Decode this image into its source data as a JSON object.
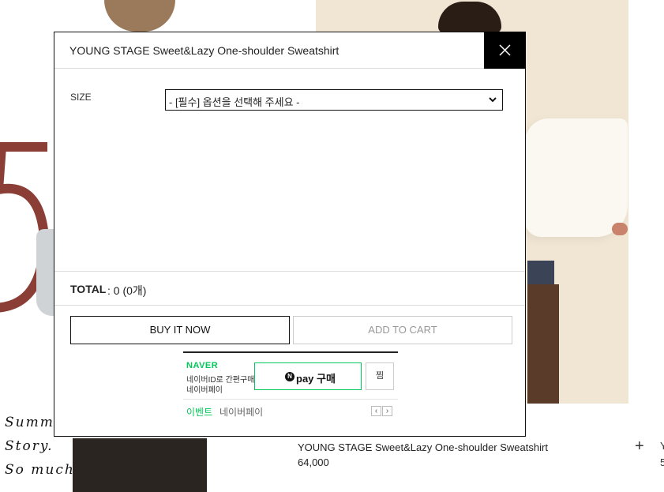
{
  "modal": {
    "title": "YOUNG STAGE Sweet&Lazy One-shoulder Sweatshirt",
    "size_label": "SIZE",
    "size_select_value": "- [필수] 옵션을 선택해 주세요 -",
    "total_label": "TOTAL",
    "total_value": ": 0 (0개)",
    "buy_now_label": "BUY IT NOW",
    "add_to_cart_label": "ADD TO CART"
  },
  "naver_pay": {
    "logo": "NAVER",
    "desc_line1": "네이버ID로 간편구매",
    "desc_line2": "네이버페이",
    "pay_button_label": "pay 구매",
    "pay_button_icon": "N",
    "wish_label": "찜",
    "event_label": "이벤트",
    "event_sub": "네이버페이",
    "accent_color": "#03c75a"
  },
  "background": {
    "product_name": "YOUNG STAGE Sweet&Lazy One-shoulder Sweatshirt",
    "product_price": "64,000",
    "handwriting": [
      "Summ",
      "Story.",
      "So much"
    ],
    "edge_text_1": "Y",
    "edge_text_2": "5"
  }
}
